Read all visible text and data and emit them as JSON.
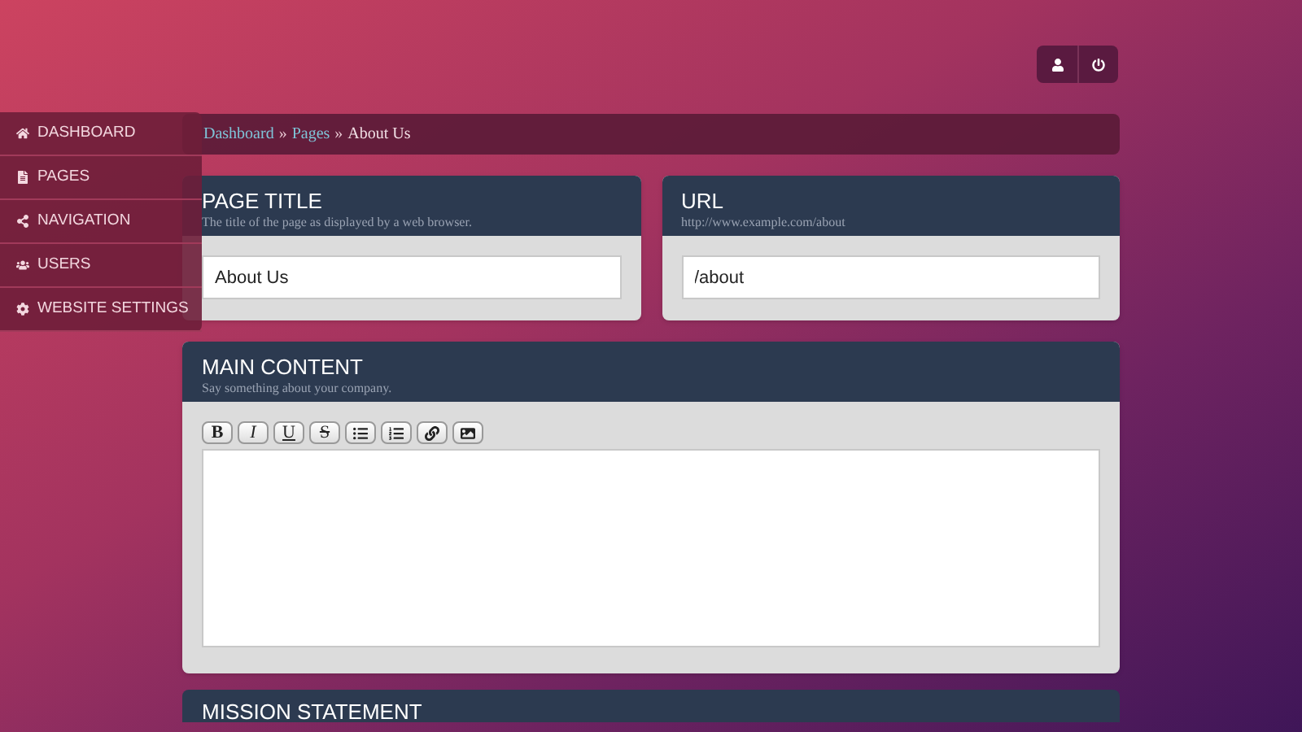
{
  "header_buttons": [
    {
      "kind": "user"
    },
    {
      "kind": "power"
    }
  ],
  "sidebar": {
    "items": [
      {
        "label": "DASHBOARD",
        "kind": "home"
      },
      {
        "label": "PAGES",
        "kind": "page"
      },
      {
        "label": "NAVIGATION",
        "kind": "share"
      },
      {
        "label": "USERS",
        "kind": "users"
      },
      {
        "label": "WEBSITE SETTINGS",
        "kind": "gear"
      }
    ]
  },
  "breadcrumb": {
    "links": [
      "Dashboard",
      "Pages"
    ],
    "separator": "»",
    "current": "About Us"
  },
  "fields": [
    {
      "title": "PAGE TITLE",
      "subtitle": "The title of the page as displayed by a web browser.",
      "value": "About Us"
    },
    {
      "title": "URL",
      "subtitle": "http://www.example.com/about",
      "value": "/about"
    }
  ],
  "main_content": {
    "title": "MAIN CONTENT",
    "subtitle": "Say something about your company.",
    "toolbar": [
      {
        "kind": "bold",
        "label": "B"
      },
      {
        "kind": "italic",
        "label": "I"
      },
      {
        "kind": "underline",
        "label": "U"
      },
      {
        "kind": "strike",
        "label": "S"
      },
      {
        "kind": "bullets"
      },
      {
        "kind": "numbers"
      },
      {
        "kind": "link"
      },
      {
        "kind": "image"
      }
    ]
  },
  "next_section": {
    "title": "MISSION STATEMENT"
  }
}
